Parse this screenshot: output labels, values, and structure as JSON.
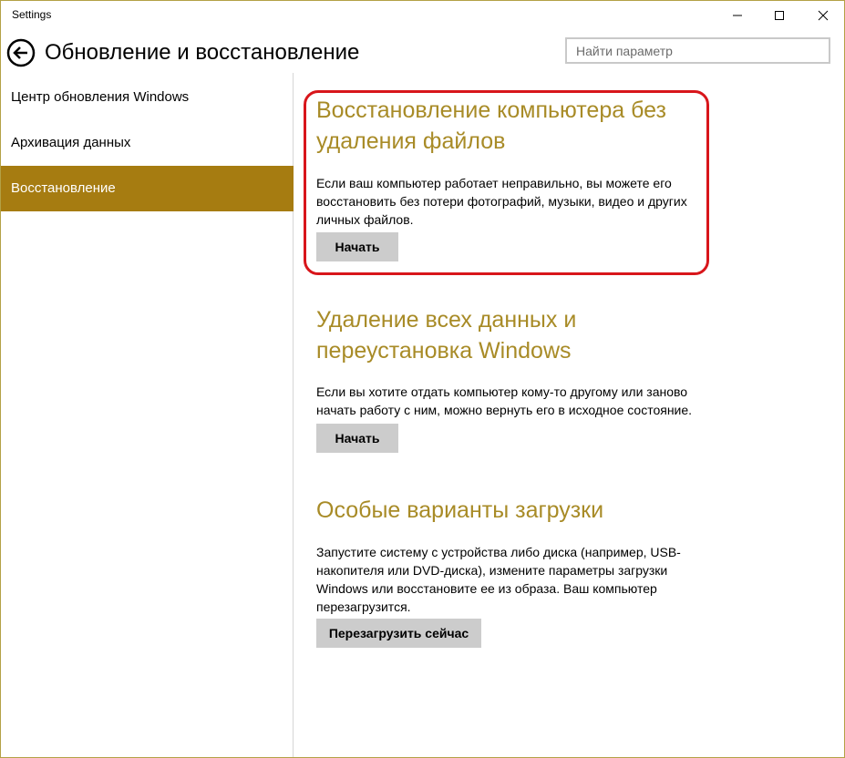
{
  "window": {
    "title": "Settings"
  },
  "header": {
    "title": "Обновление и восстановление",
    "search_placeholder": "Найти параметр"
  },
  "sidebar": {
    "items": [
      {
        "label": "Центр обновления Windows",
        "active": false
      },
      {
        "label": "Архивация данных",
        "active": false
      },
      {
        "label": "Восстановление",
        "active": true
      }
    ]
  },
  "sections": [
    {
      "title": "Восстановление компьютера без удаления файлов",
      "description": "Если ваш компьютер работает неправильно, вы можете его восстановить без потери фотографий, музыки, видео и других личных файлов.",
      "button": "Начать",
      "highlighted": true
    },
    {
      "title": "Удаление всех данных и переустановка Windows",
      "description": "Если вы хотите отдать компьютер кому-то другому или заново начать работу с ним, можно вернуть его в исходное состояние.",
      "button": "Начать"
    },
    {
      "title": "Особые варианты загрузки",
      "description": "Запустите систему с устройства либо диска (например, USB-накопителя или DVD-диска), измените параметры загрузки Windows или восстановите ее из образа. Ваш компьютер перезагрузится.",
      "button": "Перезагрузить сейчас"
    }
  ],
  "colors": {
    "accent": "#a67c11",
    "section_title": "#a88b27",
    "highlight": "#d8161b",
    "button_bg": "#cccccc"
  },
  "icons": {
    "back": "back-arrow-circle-icon",
    "minimize": "minimize-icon",
    "maximize": "maximize-icon",
    "close": "close-icon"
  }
}
